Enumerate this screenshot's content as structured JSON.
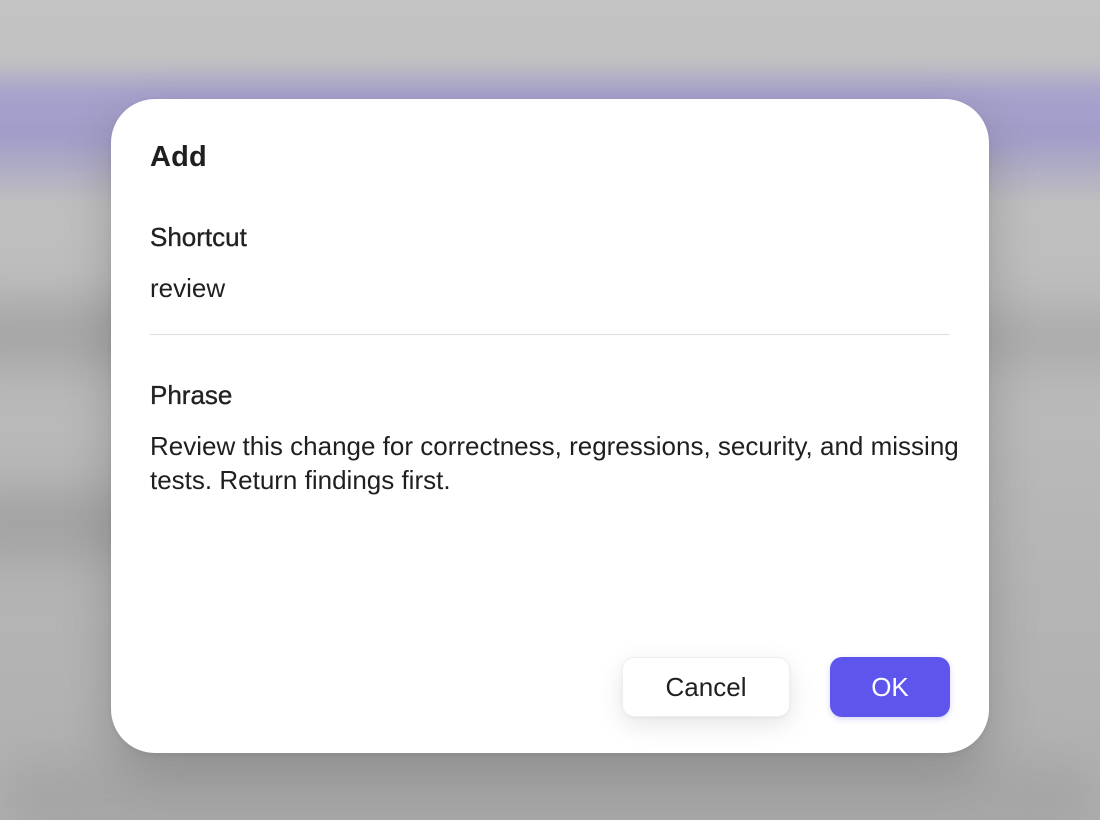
{
  "dialog": {
    "title": "Add",
    "shortcut": {
      "label": "Shortcut",
      "value": "review"
    },
    "phrase": {
      "label": "Phrase",
      "value": "Review this change for correctness, regressions, security, and missing tests. Return findings first."
    },
    "buttons": {
      "cancel_label": "Cancel",
      "ok_label": "OK"
    }
  },
  "colors": {
    "accent": "#5e55ec",
    "backdrop_band": "#a7a2cd",
    "dialog_background": "#ffffff"
  }
}
